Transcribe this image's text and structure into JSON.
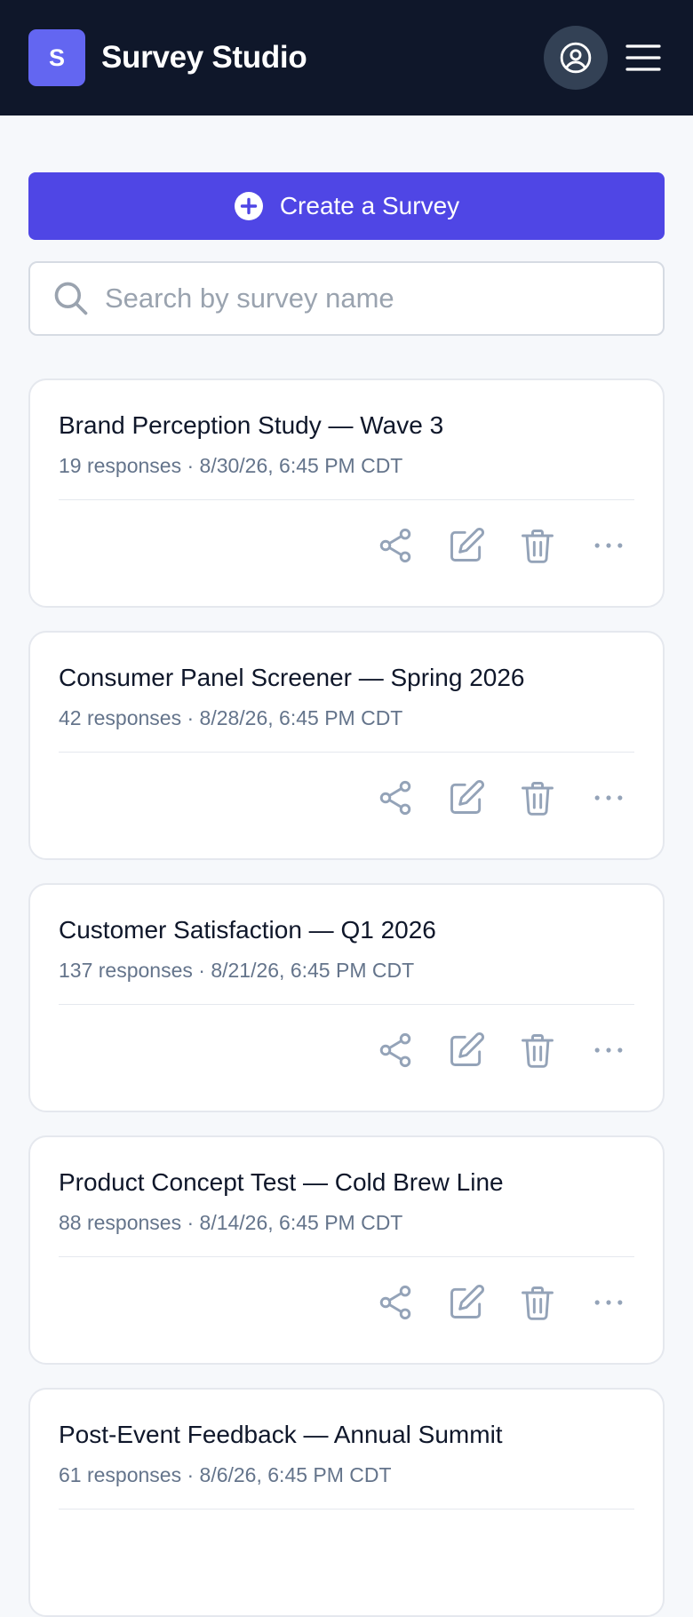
{
  "app": {
    "logo_letter": "S",
    "title": "Survey Studio"
  },
  "create_button": {
    "label": "Create a Survey"
  },
  "search": {
    "placeholder": "Search by survey name",
    "value": ""
  },
  "surveys": [
    {
      "title": "Brand Perception Study — Wave 3",
      "meta": "19 responses · 8/30/26, 6:45 PM CDT"
    },
    {
      "title": "Consumer Panel Screener — Spring 2026",
      "meta": "42 responses · 8/28/26, 6:45 PM CDT"
    },
    {
      "title": "Customer Satisfaction — Q1 2026",
      "meta": "137 responses · 8/21/26, 6:45 PM CDT"
    },
    {
      "title": "Product Concept Test — Cold Brew Line",
      "meta": "88 responses · 8/14/26, 6:45 PM CDT"
    },
    {
      "title": "Post-Event Feedback — Annual Summit",
      "meta": "61 responses · 8/6/26, 6:45 PM CDT"
    }
  ],
  "icons": {
    "profile": "user-circle-icon",
    "menu": "hamburger-menu-icon",
    "create": "plus-circle-icon",
    "search": "search-icon",
    "share": "share-icon",
    "edit": "edit-icon",
    "delete": "trash-icon",
    "more": "more-horizontal-icon"
  },
  "colors": {
    "header_bg": "#0f172a",
    "accent": "#4f46e5",
    "logo_bg": "#6366f1",
    "icon_gray": "#94a3b8"
  }
}
